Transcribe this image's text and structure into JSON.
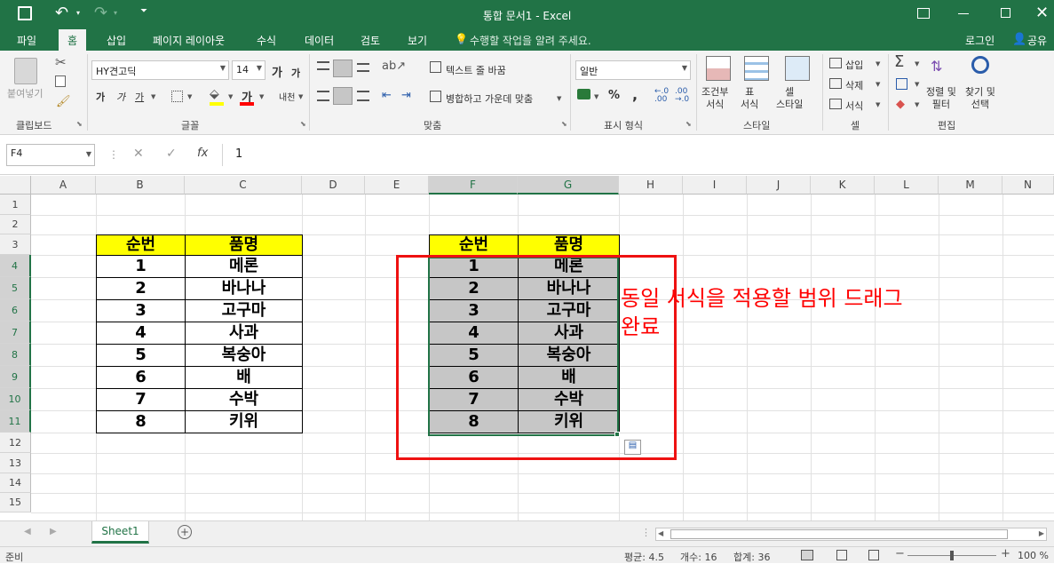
{
  "window": {
    "title": "통합 문서1 - Excel"
  },
  "tabs": [
    "파일",
    "홈",
    "삽입",
    "페이지 레이아웃",
    "수식",
    "데이터",
    "검토",
    "보기"
  ],
  "tell_me": "수행할 작업을 알려 주세요.",
  "account": {
    "login": "로그인",
    "share": "공유"
  },
  "ribbon": {
    "clipboard": {
      "paste": "붙여넣기",
      "label": "클립보드"
    },
    "font": {
      "name": "HY견고딕",
      "size": "14",
      "bold": "가",
      "italic": "가",
      "underline": "가",
      "label": "글꼴",
      "grow": "가",
      "shrink": "가",
      "font_color_glyph": "가",
      "phonetic": "내천"
    },
    "alignment": {
      "wrap": "텍스트 줄 바꿈",
      "merge": "병합하고 가운데 맞춤",
      "label": "맞춤"
    },
    "number": {
      "format": "일반",
      "percent": "%",
      "comma": ",",
      "label": "표시 형식",
      "inc": "←.0\n.00",
      "dec": ".00\n→.0"
    },
    "styles": {
      "conditional": "조건부\n서식",
      "table": "표\n서식",
      "cell": "셀\n스타일",
      "label": "스타일"
    },
    "cells": {
      "insert": "삽입",
      "delete": "삭제",
      "format": "서식",
      "label": "셀"
    },
    "editing": {
      "sort": "정렬 및\n필터",
      "find": "찾기 및\n선택",
      "label": "편집"
    }
  },
  "formula_bar": {
    "name_box": "F4",
    "fx": "fx",
    "value": "1"
  },
  "columns": [
    "A",
    "B",
    "C",
    "D",
    "E",
    "F",
    "G",
    "H",
    "I",
    "J",
    "K",
    "L",
    "M",
    "N"
  ],
  "rows": [
    "1",
    "2",
    "3",
    "4",
    "5",
    "6",
    "7",
    "8",
    "9",
    "10",
    "11",
    "12",
    "13",
    "14",
    "15"
  ],
  "table_left": {
    "header": [
      "순번",
      "품명"
    ],
    "rows": [
      [
        "1",
        "메론"
      ],
      [
        "2",
        "바나나"
      ],
      [
        "3",
        "고구마"
      ],
      [
        "4",
        "사과"
      ],
      [
        "5",
        "복숭아"
      ],
      [
        "6",
        "배"
      ],
      [
        "7",
        "수박"
      ],
      [
        "8",
        "키위"
      ]
    ]
  },
  "table_right": {
    "header": [
      "순번",
      "품명"
    ],
    "rows": [
      [
        "1",
        "메론"
      ],
      [
        "2",
        "바나나"
      ],
      [
        "3",
        "고구마"
      ],
      [
        "4",
        "사과"
      ],
      [
        "5",
        "복숭아"
      ],
      [
        "6",
        "배"
      ],
      [
        "7",
        "수박"
      ],
      [
        "8",
        "키위"
      ]
    ]
  },
  "annotation": {
    "line1": "동일 서식을 적용할 범위 드래그",
    "line2": "완료",
    "color": "#ff0000"
  },
  "sheets": [
    "Sheet1"
  ],
  "status": {
    "ready": "준비",
    "average": "평균: 4.5",
    "count": "개수: 16",
    "sum": "합계: 36",
    "zoom": "100 %"
  },
  "colors": {
    "accent": "#217346",
    "header_fill": "#ffff00",
    "selection_fill": "#c6c6c6"
  }
}
